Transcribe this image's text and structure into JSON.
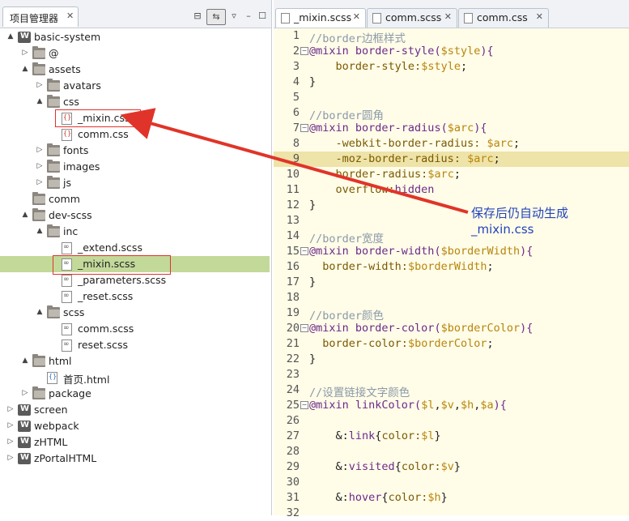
{
  "panel": {
    "title": "项目管理器",
    "close": "✕",
    "toolbar": {
      "collapse": "⊟",
      "link": "⇆",
      "menu": "▿",
      "minimize": "–",
      "maximize": "☐"
    }
  },
  "tree": [
    {
      "label": "basic-system",
      "depth": 0,
      "arrow": "▲",
      "icon": "proj"
    },
    {
      "label": "@",
      "depth": 1,
      "arrow": "▷",
      "icon": "folder"
    },
    {
      "label": "assets",
      "depth": 1,
      "arrow": "▲",
      "icon": "folder"
    },
    {
      "label": "avatars",
      "depth": 2,
      "arrow": "▷",
      "icon": "folder"
    },
    {
      "label": "css",
      "depth": 2,
      "arrow": "▲",
      "icon": "folder"
    },
    {
      "label": "_mixin.css",
      "depth": 3,
      "arrow": "",
      "icon": "css"
    },
    {
      "label": "comm.css",
      "depth": 3,
      "arrow": "",
      "icon": "css"
    },
    {
      "label": "fonts",
      "depth": 2,
      "arrow": "▷",
      "icon": "folder"
    },
    {
      "label": "images",
      "depth": 2,
      "arrow": "▷",
      "icon": "folder"
    },
    {
      "label": "js",
      "depth": 2,
      "arrow": "▷",
      "icon": "folder"
    },
    {
      "label": "comm",
      "depth": 1,
      "arrow": "",
      "icon": "folder"
    },
    {
      "label": "dev-scss",
      "depth": 1,
      "arrow": "▲",
      "icon": "folder"
    },
    {
      "label": "inc",
      "depth": 2,
      "arrow": "▲",
      "icon": "folder"
    },
    {
      "label": "_extend.scss",
      "depth": 3,
      "arrow": "",
      "icon": "scss"
    },
    {
      "label": "_mixin.scss",
      "depth": 3,
      "arrow": "",
      "icon": "scss",
      "selected": true
    },
    {
      "label": "_parameters.scss",
      "depth": 3,
      "arrow": "",
      "icon": "scss"
    },
    {
      "label": "_reset.scss",
      "depth": 3,
      "arrow": "",
      "icon": "scss"
    },
    {
      "label": "scss",
      "depth": 2,
      "arrow": "▲",
      "icon": "folder"
    },
    {
      "label": "comm.scss",
      "depth": 3,
      "arrow": "",
      "icon": "scss"
    },
    {
      "label": "reset.scss",
      "depth": 3,
      "arrow": "",
      "icon": "scss"
    },
    {
      "label": "html",
      "depth": 1,
      "arrow": "▲",
      "icon": "folder"
    },
    {
      "label": "首页.html",
      "depth": 2,
      "arrow": "",
      "icon": "html"
    },
    {
      "label": "package",
      "depth": 1,
      "arrow": "▷",
      "icon": "folder"
    },
    {
      "label": "screen",
      "depth": 0,
      "arrow": "▷",
      "icon": "proj"
    },
    {
      "label": "webpack",
      "depth": 0,
      "arrow": "▷",
      "icon": "proj"
    },
    {
      "label": "zHTML",
      "depth": 0,
      "arrow": "▷",
      "icon": "proj"
    },
    {
      "label": "zPortalHTML",
      "depth": 0,
      "arrow": "▷",
      "icon": "proj"
    }
  ],
  "tabs": [
    {
      "label": "_mixin.scss",
      "active": true
    },
    {
      "label": "comm.scss",
      "active": false
    },
    {
      "label": "comm.css",
      "active": false
    }
  ],
  "tab_close": "✕",
  "code": [
    {
      "n": "1",
      "fold": false,
      "tokens": [
        [
          "c-com",
          "//border边框样式"
        ]
      ]
    },
    {
      "n": "2",
      "fold": true,
      "tokens": [
        [
          "c-kw",
          "@mixin "
        ],
        [
          "c-fn",
          "border-style("
        ],
        [
          "c-var",
          "$style"
        ],
        [
          "c-fn",
          "){"
        ]
      ]
    },
    {
      "n": "3",
      "fold": false,
      "tokens": [
        [
          "c-pl",
          "    "
        ],
        [
          "c-prop",
          "border-style:"
        ],
        [
          "c-var",
          "$style"
        ],
        [
          "c-pl",
          ";"
        ]
      ]
    },
    {
      "n": "4",
      "fold": false,
      "tokens": [
        [
          "c-pl",
          "}"
        ]
      ]
    },
    {
      "n": "5",
      "fold": false,
      "tokens": []
    },
    {
      "n": "6",
      "fold": false,
      "tokens": [
        [
          "c-com",
          "//border圆角"
        ]
      ]
    },
    {
      "n": "7",
      "fold": true,
      "tokens": [
        [
          "c-kw",
          "@mixin "
        ],
        [
          "c-fn",
          "border-radius("
        ],
        [
          "c-var",
          "$arc"
        ],
        [
          "c-fn",
          "){"
        ]
      ]
    },
    {
      "n": "8",
      "fold": false,
      "tokens": [
        [
          "c-pl",
          "    "
        ],
        [
          "c-prop",
          "-webkit-border-radius: "
        ],
        [
          "c-var",
          "$arc"
        ],
        [
          "c-pl",
          ";"
        ]
      ]
    },
    {
      "n": "9",
      "fold": false,
      "hl": true,
      "tokens": [
        [
          "c-pl",
          "    "
        ],
        [
          "c-prop",
          "-moz-border-radius: "
        ],
        [
          "c-var",
          "$arc"
        ],
        [
          "c-pl",
          ";"
        ]
      ]
    },
    {
      "n": "10",
      "fold": false,
      "tokens": [
        [
          "c-pl",
          "    "
        ],
        [
          "c-prop",
          "border-radius:"
        ],
        [
          "c-var",
          "$arc"
        ],
        [
          "c-pl",
          ";"
        ]
      ]
    },
    {
      "n": "11",
      "fold": false,
      "tokens": [
        [
          "c-pl",
          "    "
        ],
        [
          "c-prop",
          "overflow:"
        ],
        [
          "c-kw",
          "hidden"
        ]
      ]
    },
    {
      "n": "12",
      "fold": false,
      "tokens": [
        [
          "c-pl",
          "}"
        ]
      ]
    },
    {
      "n": "13",
      "fold": false,
      "tokens": []
    },
    {
      "n": "14",
      "fold": false,
      "tokens": [
        [
          "c-com",
          "//border宽度"
        ]
      ]
    },
    {
      "n": "15",
      "fold": true,
      "tokens": [
        [
          "c-kw",
          "@mixin "
        ],
        [
          "c-fn",
          "border-width("
        ],
        [
          "c-var",
          "$borderWidth"
        ],
        [
          "c-fn",
          "){"
        ]
      ]
    },
    {
      "n": "16",
      "fold": false,
      "tokens": [
        [
          "c-pl",
          "  "
        ],
        [
          "c-prop",
          "border-width:"
        ],
        [
          "c-var",
          "$borderWidth"
        ],
        [
          "c-pl",
          ";"
        ]
      ]
    },
    {
      "n": "17",
      "fold": false,
      "tokens": [
        [
          "c-pl",
          "}"
        ]
      ]
    },
    {
      "n": "18",
      "fold": false,
      "tokens": []
    },
    {
      "n": "19",
      "fold": false,
      "tokens": [
        [
          "c-com",
          "//border颜色"
        ]
      ]
    },
    {
      "n": "20",
      "fold": true,
      "tokens": [
        [
          "c-kw",
          "@mixin "
        ],
        [
          "c-fn",
          "border-color("
        ],
        [
          "c-var",
          "$borderColor"
        ],
        [
          "c-fn",
          "){"
        ]
      ]
    },
    {
      "n": "21",
      "fold": false,
      "tokens": [
        [
          "c-pl",
          "  "
        ],
        [
          "c-prop",
          "border-color:"
        ],
        [
          "c-var",
          "$borderColor"
        ],
        [
          "c-pl",
          ";"
        ]
      ]
    },
    {
      "n": "22",
      "fold": false,
      "tokens": [
        [
          "c-pl",
          "}"
        ]
      ]
    },
    {
      "n": "23",
      "fold": false,
      "tokens": []
    },
    {
      "n": "24",
      "fold": false,
      "tokens": [
        [
          "c-com",
          "//设置链接文字颜色"
        ]
      ]
    },
    {
      "n": "25",
      "fold": true,
      "tokens": [
        [
          "c-kw",
          "@mixin "
        ],
        [
          "c-fn",
          "linkColor("
        ],
        [
          "c-var",
          "$l"
        ],
        [
          "c-pl",
          ","
        ],
        [
          "c-var",
          "$v"
        ],
        [
          "c-pl",
          ","
        ],
        [
          "c-var",
          "$h"
        ],
        [
          "c-pl",
          ","
        ],
        [
          "c-var",
          "$a"
        ],
        [
          "c-fn",
          "){"
        ]
      ]
    },
    {
      "n": "26",
      "fold": false,
      "tokens": []
    },
    {
      "n": "27",
      "fold": false,
      "tokens": [
        [
          "c-pl",
          "    &:"
        ],
        [
          "c-kw",
          "link"
        ],
        [
          "c-pl",
          "{"
        ],
        [
          "c-prop",
          "color:"
        ],
        [
          "c-var",
          "$l"
        ],
        [
          "c-pl",
          "}"
        ]
      ]
    },
    {
      "n": "28",
      "fold": false,
      "tokens": []
    },
    {
      "n": "29",
      "fold": false,
      "tokens": [
        [
          "c-pl",
          "    &:"
        ],
        [
          "c-kw",
          "visited"
        ],
        [
          "c-pl",
          "{"
        ],
        [
          "c-prop",
          "color:"
        ],
        [
          "c-var",
          "$v"
        ],
        [
          "c-pl",
          "}"
        ]
      ]
    },
    {
      "n": "30",
      "fold": false,
      "tokens": []
    },
    {
      "n": "31",
      "fold": false,
      "tokens": [
        [
          "c-pl",
          "    &:"
        ],
        [
          "c-kw",
          "hover"
        ],
        [
          "c-pl",
          "{"
        ],
        [
          "c-prop",
          "color:"
        ],
        [
          "c-var",
          "$h"
        ],
        [
          "c-pl",
          "}"
        ]
      ]
    },
    {
      "n": "32",
      "fold": false,
      "tokens": []
    }
  ],
  "annotation": {
    "line1": "保存后仍自动生成",
    "line2": "_mixin.css",
    "color": "#e0342a"
  }
}
